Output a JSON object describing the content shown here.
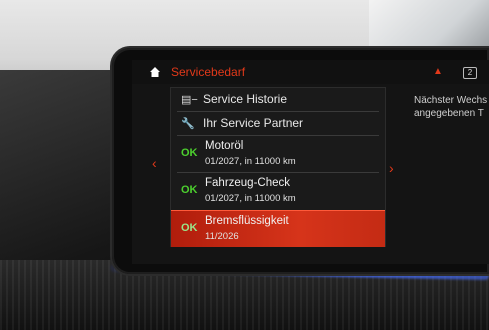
{
  "header": {
    "title": "Servicebedarf",
    "badge": "2"
  },
  "menu": [
    {
      "icon": "vehicle-history-icon",
      "label": "Service Historie"
    },
    {
      "icon": "wrench-icon",
      "label": "Ihr Service Partner"
    }
  ],
  "items": [
    {
      "status": "OK",
      "name": "Motoröl",
      "detail": "01/2027, in 11000 km"
    },
    {
      "status": "OK",
      "name": "Fahrzeug-Check",
      "detail": "01/2027, in 11000 km"
    },
    {
      "status": "OK",
      "name": "Bremsflüssigkeit",
      "detail": "11/2026"
    }
  ],
  "side_panel": {
    "line1": "Nächster Wechs",
    "line2": "angegebenen T"
  },
  "colors": {
    "accent": "#e2391a",
    "ok": "#4ccf2e",
    "highlight": "#c42b14"
  }
}
